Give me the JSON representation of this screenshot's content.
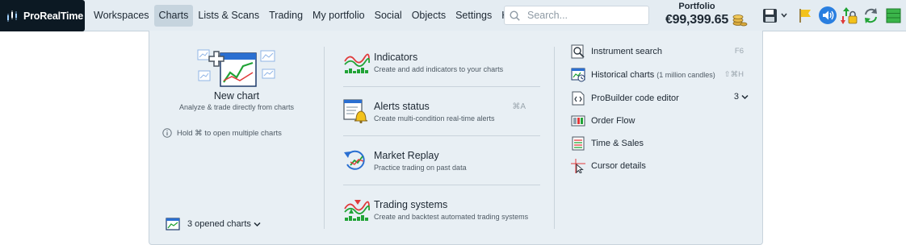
{
  "app": {
    "name": "ProRealTime"
  },
  "menu": {
    "items": [
      "Workspaces",
      "Charts",
      "Lists & Scans",
      "Trading",
      "My portfolio",
      "Social",
      "Objects",
      "Settings",
      "Help"
    ],
    "active": "Charts"
  },
  "search": {
    "placeholder": "Search..."
  },
  "portfolio": {
    "label": "Portfolio",
    "value": "€99,399.65"
  },
  "toolbar_icons": [
    "save-icon",
    "chevron-down-icon",
    "flag-icon",
    "sound-icon",
    "alert-lock-icon",
    "refresh-icon",
    "layout-icon"
  ],
  "dropdown": {
    "new_chart": {
      "title": "New chart",
      "subtitle": "Analyze & trade directly from charts"
    },
    "hint": "Hold ⌘ to open multiple charts",
    "opened_charts": "3 opened charts",
    "features": [
      {
        "title": "Indicators",
        "subtitle": "Create and add indicators to your charts",
        "shortcut": ""
      },
      {
        "title": "Alerts status",
        "subtitle": "Create multi-condition real-time alerts",
        "shortcut": "⌘A"
      },
      {
        "title": "Market Replay",
        "subtitle": "Practice trading on past data",
        "shortcut": ""
      },
      {
        "title": "Trading systems",
        "subtitle": "Create and backtest automated trading systems",
        "shortcut": ""
      }
    ],
    "tools": [
      {
        "label": "Instrument search",
        "note": "",
        "shortcut": "F6"
      },
      {
        "label": "Historical charts",
        "note": "(1 million candles)",
        "shortcut": "⇧⌘H"
      },
      {
        "label": "ProBuilder code editor",
        "note": "",
        "count": "3"
      },
      {
        "label": "Order Flow",
        "note": ""
      },
      {
        "label": "Time & Sales",
        "note": ""
      },
      {
        "label": "Cursor details",
        "note": ""
      }
    ]
  },
  "colors": {
    "accent": "#2a6fd1",
    "topbar": "#e4ecf2",
    "dropdown": "#e8eff4",
    "green": "#21a336",
    "red": "#e03a3a"
  }
}
